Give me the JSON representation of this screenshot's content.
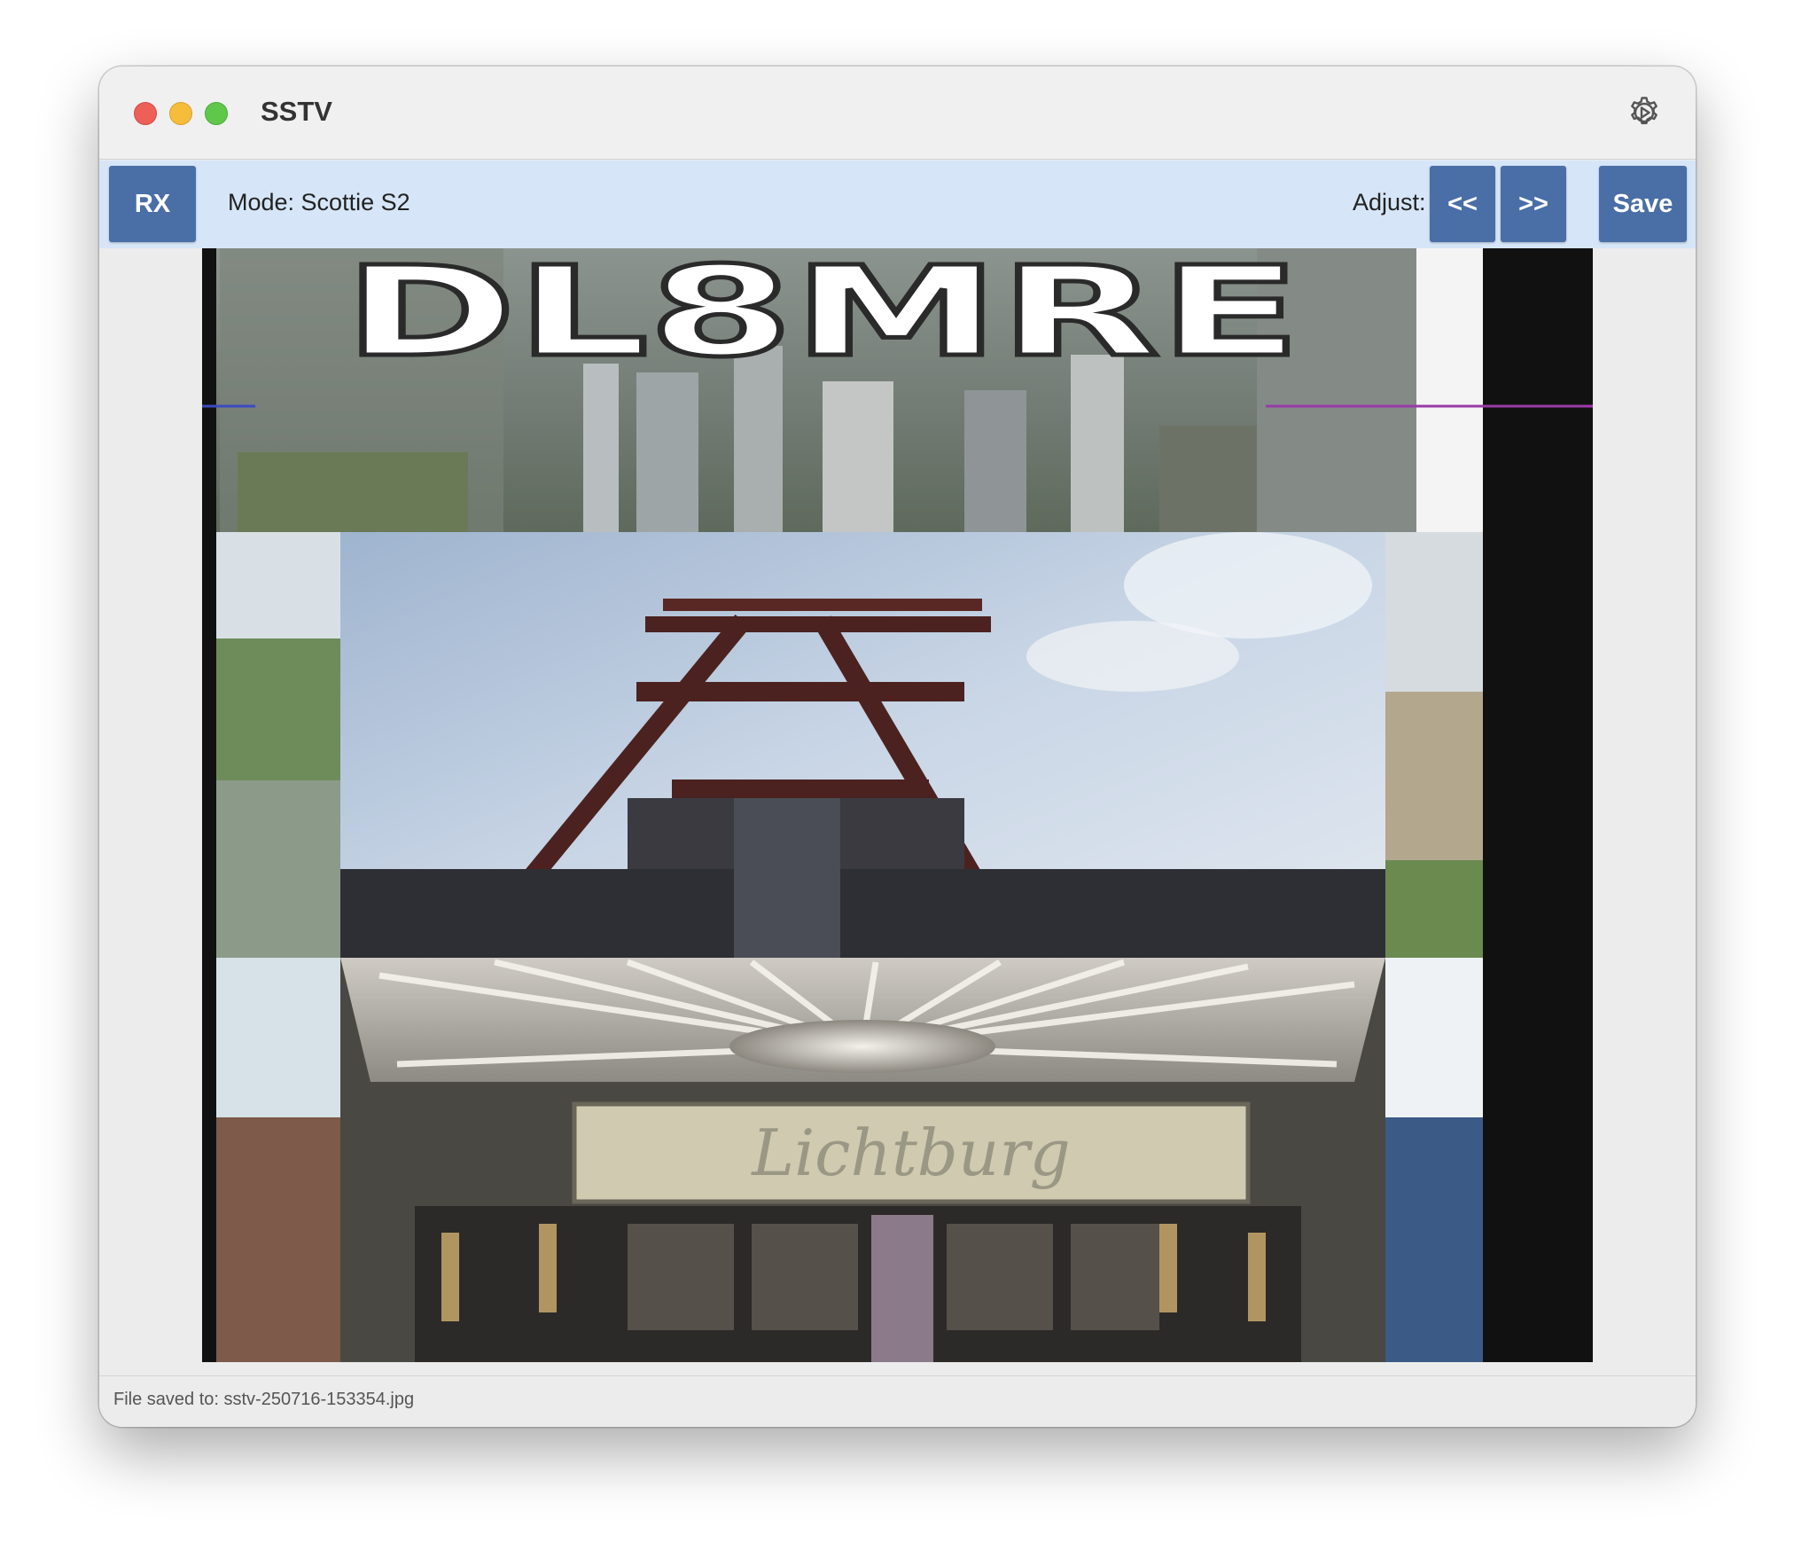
{
  "window": {
    "title": "SSTV"
  },
  "toolbar": {
    "rx_label": "RX",
    "mode_text": "Mode: Scottie S2",
    "adjust_label": "Adjust:",
    "adjust_left_label": "<<",
    "adjust_right_label": ">>",
    "save_label": "Save"
  },
  "image": {
    "callsign": "DL8MRE",
    "sign_text": "Lichtburg"
  },
  "status": {
    "text": "File saved to: sstv-250716-153354.jpg"
  },
  "icons": {
    "settings": "gear-icon"
  },
  "colors": {
    "button": "#4a6ea6",
    "toolbar_bg": "#d6e6f8",
    "close": "#ed5f57",
    "minimize": "#f5bd39",
    "maximize": "#5fc84a"
  }
}
